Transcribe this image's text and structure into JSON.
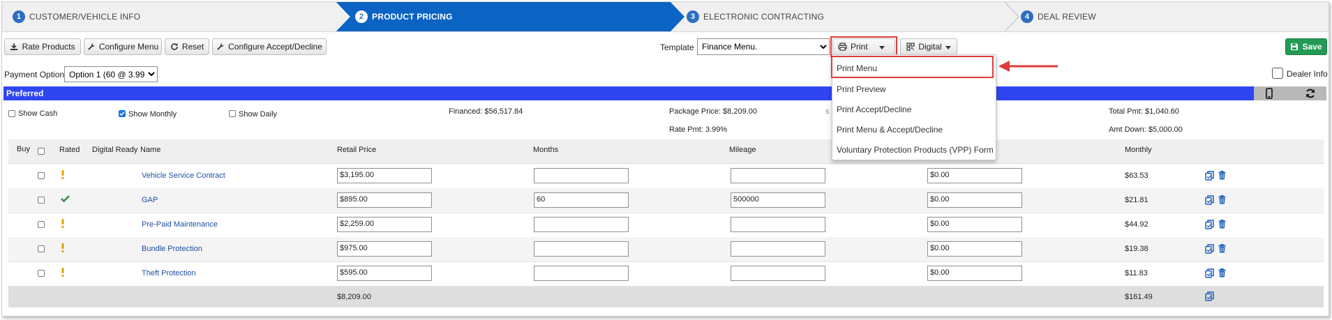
{
  "steps": [
    {
      "num": "1",
      "label": "CUSTOMER/VEHICLE INFO"
    },
    {
      "num": "2",
      "label": "PRODUCT PRICING"
    },
    {
      "num": "3",
      "label": "ELECTRONIC CONTRACTING"
    },
    {
      "num": "4",
      "label": "DEAL REVIEW"
    }
  ],
  "toolbar": {
    "rate_products": "Rate Products",
    "configure_menu": "Configure Menu",
    "reset": "Reset",
    "configure_accept_decline": "Configure Accept/Decline",
    "template_label": "Template",
    "template_value": "Finance Menu.",
    "print": "Print",
    "digital": "Digital",
    "save": "Save"
  },
  "payment": {
    "label": "Payment Option",
    "value": "Option 1 (60 @ 3.99%)"
  },
  "dealer_info": "Dealer Info",
  "section_title": "Preferred",
  "options": {
    "show_cash": "Show Cash",
    "show_monthly": "Show Monthly",
    "show_daily": "Show Daily",
    "show_monthly_checked": true
  },
  "summary": {
    "financed": "Financed: $56,517.84",
    "package_price": "Package Price: $8,209.00",
    "rate_pmt": "Rate Pmt: 3.99%",
    "total_pmt": "Total Pmt: $1,040.60",
    "amt_down": "Amt Down: $5,000.00",
    "partial_char": "s"
  },
  "print_menu": [
    "Print Menu",
    "Print Preview",
    "Print Accept/Decline",
    "Print Menu & Accept/Decline",
    "Voluntary Protection Products (VPP) Form"
  ],
  "columns": {
    "buy": "Buy",
    "rated": "Rated",
    "digital_ready": "Digital Ready",
    "name": "Name",
    "retail_price": "Retail Price",
    "months": "Months",
    "mileage": "Mileage",
    "monthly": "Monthly"
  },
  "products": [
    {
      "status": "warning",
      "name": "Vehicle Service Contract",
      "retail": "$3,195.00",
      "months": "",
      "mileage": "",
      "deductible": "$0.00",
      "monthly": "$63.53"
    },
    {
      "status": "check",
      "name": "GAP",
      "retail": "$895.00",
      "months": "60",
      "mileage": "500000",
      "deductible": "$0.00",
      "monthly": "$21.81"
    },
    {
      "status": "warning",
      "name": "Pre-Paid Maintenance",
      "retail": "$2,259.00",
      "months": "",
      "mileage": "",
      "deductible": "$0.00",
      "monthly": "$44.92"
    },
    {
      "status": "warning",
      "name": "Bundle Protection",
      "retail": "$975.00",
      "months": "",
      "mileage": "",
      "deductible": "$0.00",
      "monthly": "$19.38"
    },
    {
      "status": "warning",
      "name": "Theft Protection",
      "retail": "$595.00",
      "months": "",
      "mileage": "",
      "deductible": "$0.00",
      "monthly": "$11.83"
    }
  ],
  "totals": {
    "retail": "$8,209.00",
    "monthly": "$161.49"
  },
  "colors": {
    "accent": "#2c6fc1",
    "bar": "#2f45f2",
    "save": "#239a55",
    "highlight": "#e03a3a",
    "warning": "#e0a000",
    "check": "#2e8b3e"
  }
}
